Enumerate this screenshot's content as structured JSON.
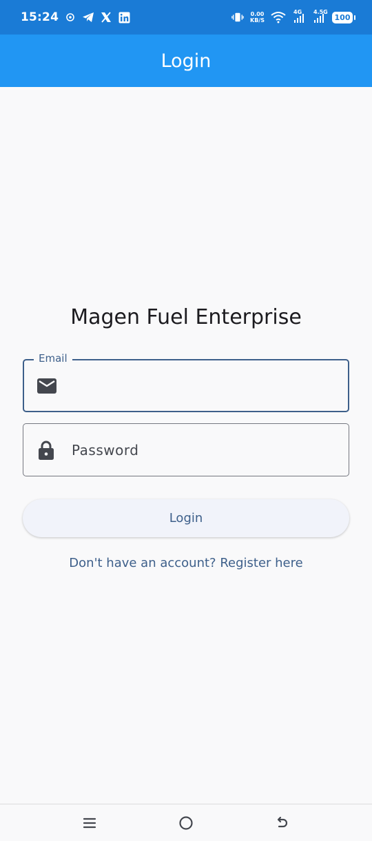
{
  "status_bar": {
    "time": "15:24",
    "speed_value": "0.00",
    "speed_unit": "KB/S",
    "net1_label": "4G",
    "net2_label": "4.5G",
    "battery": "100",
    "icons": [
      "settings-icon",
      "telegram-icon",
      "x-icon",
      "linkedin-icon",
      "vibrate-icon",
      "wifi-icon",
      "signal-icon",
      "battery-icon"
    ]
  },
  "app_bar": {
    "title": "Login"
  },
  "main": {
    "brand_title": "Magen Fuel Enterprise",
    "email": {
      "label": "Email",
      "value": "",
      "icon": "mail-icon"
    },
    "password": {
      "placeholder": "Password",
      "value": "",
      "icon": "lock-icon"
    },
    "login_button": "Login",
    "register_link": "Don't have an account? Register here"
  },
  "nav_bar": {
    "icons": [
      "menu-icon",
      "home-icon",
      "back-icon"
    ]
  },
  "colors": {
    "status_bar": "#1a7bd6",
    "app_bar": "#2196f3",
    "accent": "#3d5f8a",
    "background": "#f9f9fa"
  }
}
